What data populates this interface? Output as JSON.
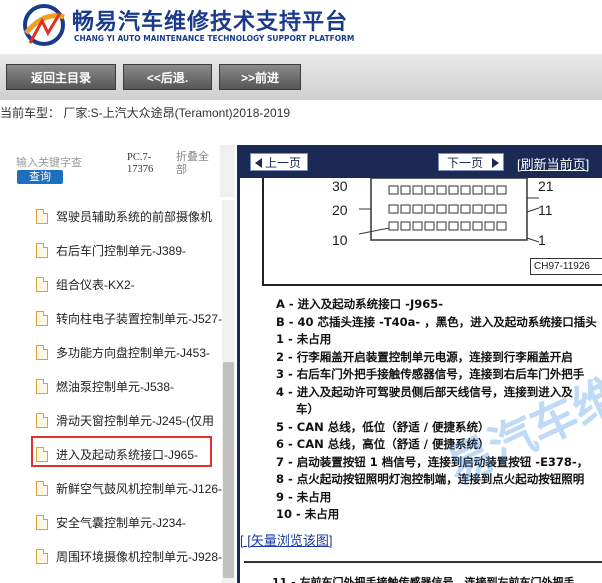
{
  "header": {
    "title": "畅易汽车维修技术支持平台",
    "subtitle": "CHANG YI AUTO MAINTENANCE TECHNOLOGY SUPPORT PLATFORM"
  },
  "nav": {
    "home": "返回主目录",
    "back": "<<后退.",
    "forward": ">>前进"
  },
  "vehicle_line": "当前车型： 厂家:S-上汽大众途昂(Teramont)2018-2019",
  "sidebar": {
    "search_placeholder": "输入关键字查",
    "search_button": "查询",
    "pc_label": "PC.7-17376",
    "collapse_all": "折叠全部",
    "items": [
      {
        "label": "驾驶员辅助系统的前部摄像机"
      },
      {
        "label": "右后车门控制单元-J389-"
      },
      {
        "label": "组合仪表-KX2-"
      },
      {
        "label": "转向柱电子装置控制单元-J527-"
      },
      {
        "label": "多功能方向盘控制单元-J453-"
      },
      {
        "label": "燃油泵控制单元-J538-"
      },
      {
        "label": "滑动天窗控制单元-J245-(仅用"
      },
      {
        "label": "进入及起动系统接口-J965-"
      },
      {
        "label": "新鲜空气鼓风机控制单元-J126-"
      },
      {
        "label": "安全气囊控制单元-J234-"
      },
      {
        "label": "周围环境摄像机控制单元-J928-"
      }
    ]
  },
  "content": {
    "prev_page": "上一页",
    "next_page": "下一页",
    "refresh": "[刷新当前页]",
    "diagram_code": "CH97-11926",
    "pin_numbers": {
      "n30": "30",
      "n20": "20",
      "n10": "10",
      "n21": "21",
      "n11": "11",
      "n1": "1"
    },
    "pins": [
      "A - 进入及起动系统接口 -J965-",
      "B - 40 芯插头连接 -T40a- ，黑色，进入及起动系统接口插头",
      "1 - 未占用",
      "2 - 行李厢盖开启装置控制单元电源，连接到行李厢盖开启",
      "3 - 右后车门外把手接触传感器信号，连接到右后车门外把手",
      "4 - 进入及起动许可驾驶员侧后部天线信号，连接到进入及",
      "车）",
      "5 - CAN 总线，低位（舒适 / 便捷系统）",
      "6 - CAN 总线，高位（舒适 / 便捷系统）",
      "7 - 启动装置按钮 1 档信号，连接到启动装置按钮 -E378-，",
      "8 - 点火起动按钮照明灯泡控制端，连接到点火起动按钮照明",
      "9 - 未占用",
      "10 - 未占用"
    ],
    "watermark": "易汽车维",
    "vector_link": "[ [矢量浏览该图]",
    "next_line": "11 - 左前车门外把手接触传感器信号，连接到左前车门外把手"
  },
  "colors": {
    "brand": "#1a3a8c",
    "toolbar": "#1a2a55",
    "highlight": "#e03030",
    "search_button": "#1f6fbf"
  }
}
